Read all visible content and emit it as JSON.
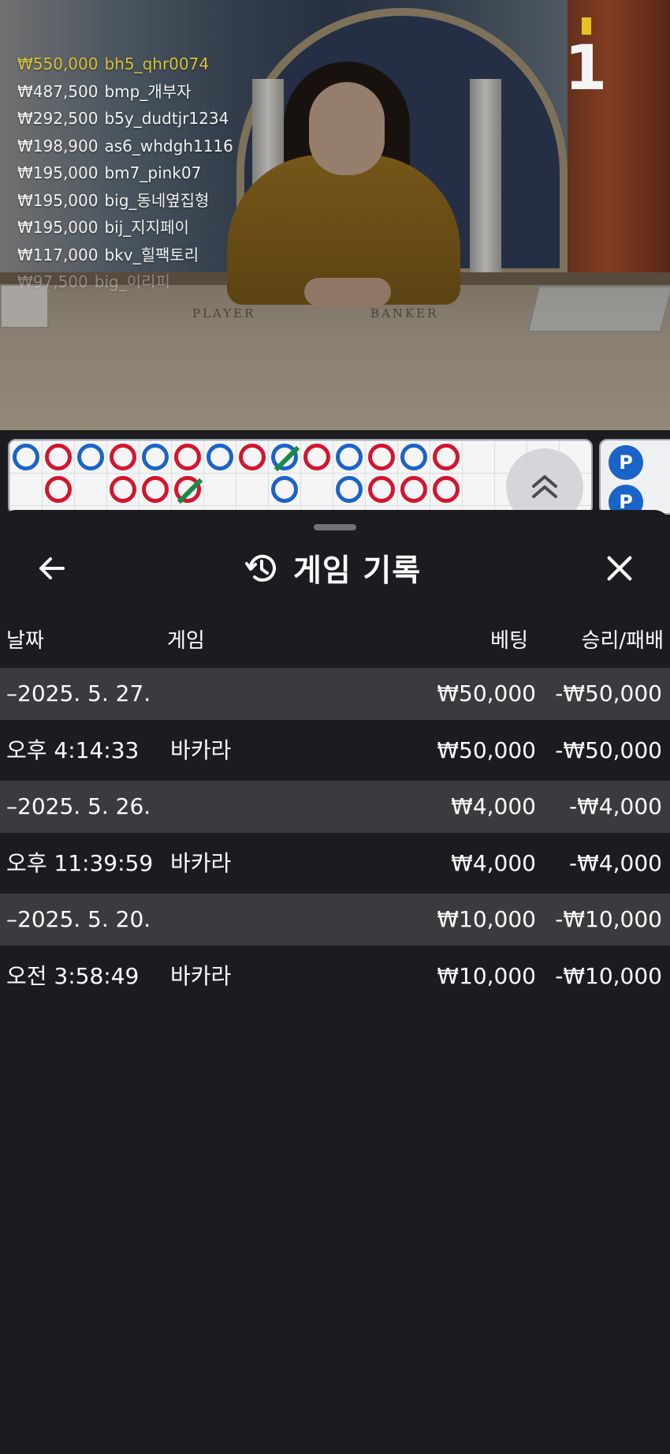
{
  "stream": {
    "round_number": "1",
    "table_labels": [
      "PLAYER",
      "BANKER"
    ],
    "bets": [
      {
        "amount": "₩550,000",
        "user": "bh5_qhr0074"
      },
      {
        "amount": "₩487,500",
        "user": "bmp_개부자"
      },
      {
        "amount": "₩292,500",
        "user": "b5y_dudtjr1234"
      },
      {
        "amount": "₩198,900",
        "user": "as6_whdgh1116"
      },
      {
        "amount": "₩195,000",
        "user": "bm7_pink07"
      },
      {
        "amount": "₩195,000",
        "user": "big_동네옆집형"
      },
      {
        "amount": "₩195,000",
        "user": "bij_지지페이"
      },
      {
        "amount": "₩117,000",
        "user": "bkv_힐팩토리"
      },
      {
        "amount": "₩97,500",
        "user": "big_이리피"
      }
    ]
  },
  "roadmap": {
    "bead_label": "P",
    "row1": [
      "blue",
      "red",
      "blue",
      "red",
      "blue",
      "red",
      "blue",
      "red",
      "tie-blue",
      "red",
      "blue",
      "red",
      "blue",
      "red"
    ],
    "row2": [
      "",
      "red",
      "",
      "red",
      "red",
      "tie-red",
      "",
      "",
      "blue",
      "",
      "blue",
      "red",
      "red",
      "red"
    ]
  },
  "history": {
    "title": "게임 기록",
    "columns": {
      "date": "날짜",
      "game": "게임",
      "bet": "베팅",
      "result": "승리/패배"
    },
    "rows": [
      {
        "kind": "date",
        "date": "–2025. 5. 27.",
        "game": "",
        "bet": "₩50,000",
        "result": "-₩50,000"
      },
      {
        "kind": "entry",
        "date": "오후 4:14:33",
        "game": "바카라",
        "bet": "₩50,000",
        "result": "-₩50,000"
      },
      {
        "kind": "date",
        "date": "–2025. 5. 26.",
        "game": "",
        "bet": "₩4,000",
        "result": "-₩4,000"
      },
      {
        "kind": "entry",
        "date": "오후 11:39:59",
        "game": "바카라",
        "bet": "₩4,000",
        "result": "-₩4,000"
      },
      {
        "kind": "date",
        "date": "–2025. 5. 20.",
        "game": "",
        "bet": "₩10,000",
        "result": "-₩10,000"
      },
      {
        "kind": "entry",
        "date": "오전 3:58:49",
        "game": "바카라",
        "bet": "₩10,000",
        "result": "-₩10,000"
      }
    ]
  },
  "icons": {
    "back": "arrow-left-icon",
    "history": "history-icon",
    "close": "close-icon",
    "expand": "chevron-double-up-icon"
  },
  "colors": {
    "banker_red": "#d3152f",
    "player_blue": "#1a63c8",
    "tie_green": "#19894a",
    "sheet_bg": "#1c1b1f",
    "date_row_bg": "#3b3a3e",
    "top_bet_gold": "#d9c23a"
  }
}
